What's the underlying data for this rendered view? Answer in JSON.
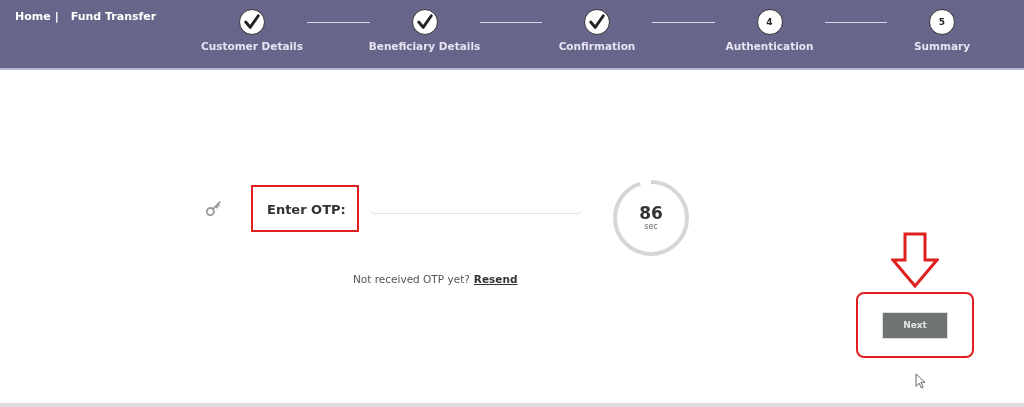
{
  "breadcrumb": {
    "home": "Home",
    "separator": "|",
    "current": "Fund Transfer"
  },
  "steps": [
    {
      "label": "Customer Details",
      "completed": true
    },
    {
      "label": "Beneficiary Details",
      "completed": true
    },
    {
      "label": "Confirmation",
      "completed": true
    },
    {
      "label": "Authentication",
      "completed": false,
      "number": "4"
    },
    {
      "label": "Summary",
      "completed": false,
      "number": "5"
    }
  ],
  "otp": {
    "label": "Enter OTP:",
    "timer": {
      "value": "86",
      "unit": "sec",
      "level": 0.95
    },
    "prompt": "Not received OTP yet?",
    "resend": "Resend"
  },
  "buttons": [
    {
      "label": "Next"
    }
  ]
}
